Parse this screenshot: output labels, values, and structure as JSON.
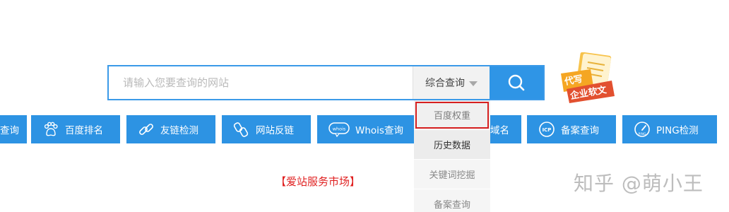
{
  "search": {
    "placeholder": "请输入您要查询的网站",
    "mode_label": "综合查询",
    "accent_color": "#2f95e6"
  },
  "dropdown": {
    "items": [
      {
        "label": "百度权重",
        "highlighted": true
      },
      {
        "label": "历史数据"
      },
      {
        "label": "关键词挖掘"
      },
      {
        "label": "备案查询"
      }
    ]
  },
  "tools": {
    "items": [
      {
        "label": "查询",
        "icon": "partial-icon"
      },
      {
        "label": "百度排名",
        "icon": "baidu-paw-icon"
      },
      {
        "label": "友链检测",
        "icon": "link-chain-icon"
      },
      {
        "label": "网站反链",
        "icon": "backlink-icon"
      },
      {
        "label": "Whois查询",
        "icon": "whois-bubble-icon"
      },
      {
        "label": "域名",
        "icon": "domain-icon"
      },
      {
        "label": "备案查询",
        "icon": "icp-icon"
      },
      {
        "label": "PING检测",
        "icon": "ping-gauge-icon"
      }
    ]
  },
  "promo_badge": {
    "line1": "代写",
    "line2": "企业软文",
    "colors": {
      "primary": "#f5a623",
      "accent": "#e2502f"
    }
  },
  "market_link": "【爱站服务市场】",
  "watermark": "知乎 @萌小王"
}
